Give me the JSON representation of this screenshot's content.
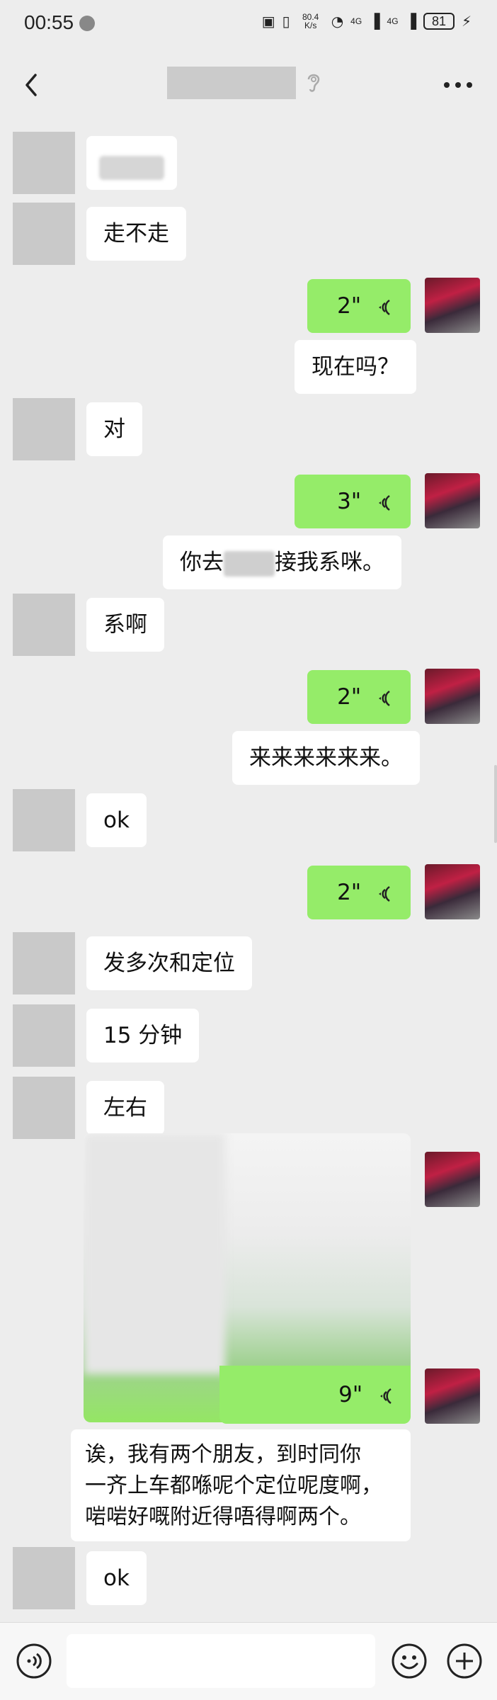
{
  "status_bar": {
    "time": "00:55",
    "net_speed": "80.4 K/s",
    "signal1": "4G",
    "signal2": "4G",
    "battery": "81"
  },
  "nav": {
    "icons": [
      "back-icon",
      "earpiece-icon",
      "more-icon"
    ]
  },
  "messages": {
    "m1": {
      "side": "left",
      "text": "走不走"
    },
    "m2": {
      "side": "right",
      "type": "voice",
      "duration": "2\""
    },
    "m3": {
      "side": "right",
      "text": "现在吗？"
    },
    "m4": {
      "side": "left",
      "text": "对"
    },
    "m5": {
      "side": "right",
      "type": "voice",
      "duration": "3\""
    },
    "m6": {
      "side": "right",
      "text_before": "你去",
      "text_after": "接我系咪。"
    },
    "m7": {
      "side": "left",
      "text": "系啊"
    },
    "m8": {
      "side": "right",
      "type": "voice",
      "duration": "2\""
    },
    "m9": {
      "side": "right",
      "text": "来来来来来来。"
    },
    "m10": {
      "side": "left",
      "text": "ok"
    },
    "m11": {
      "side": "right",
      "type": "voice",
      "duration": "2\""
    },
    "m12": {
      "side": "left",
      "text": "发多次和定位"
    },
    "m13": {
      "side": "left",
      "text": "15 分钟"
    },
    "m14": {
      "side": "left",
      "text": "左右"
    },
    "m15": {
      "side": "right",
      "type": "voice",
      "duration": "9\""
    },
    "m16": {
      "side": "right",
      "lines": [
        "诶，我有两个朋友，到时同你",
        "一齐上车都喺呢个定位呢度啊，",
        "啱啱好嘅附近得唔得啊两个。"
      ]
    },
    "m17": {
      "side": "left",
      "text": "ok"
    }
  },
  "colors": {
    "background": "#ededed",
    "green_bubble": "#95ec69",
    "white_bubble": "#ffffff"
  },
  "input_bar": {
    "icons": [
      "voice-input-icon",
      "emoji-icon",
      "plus-icon"
    ]
  }
}
